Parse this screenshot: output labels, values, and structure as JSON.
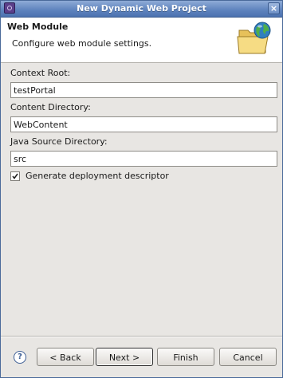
{
  "window": {
    "title": "New Dynamic Web Project",
    "close_glyph": "×"
  },
  "header": {
    "title": "Web Module",
    "description": "Configure web module settings.",
    "icon": "folder-globe-icon"
  },
  "form": {
    "context_root": {
      "label": "Context Root:",
      "value": "testPortal"
    },
    "content_directory": {
      "label": "Content Directory:",
      "value": "WebContent"
    },
    "java_source_directory": {
      "label": "Java Source Directory:",
      "value": "src"
    },
    "generate_descriptor": {
      "label": "Generate deployment descriptor",
      "checked": true
    }
  },
  "footer": {
    "help_glyph": "?",
    "back_label": "< Back",
    "next_label": "Next >",
    "finish_label": "Finish",
    "cancel_label": "Cancel"
  }
}
